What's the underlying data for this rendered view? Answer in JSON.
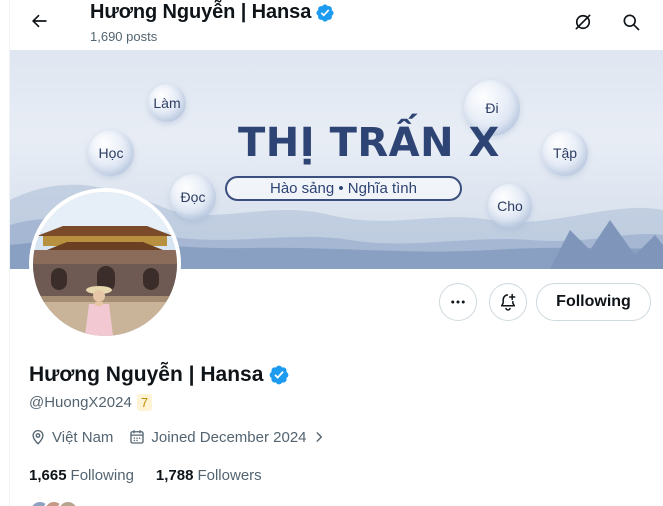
{
  "header": {
    "name": "Hương Nguyễn | Hansa",
    "posts_count": "1,690 posts"
  },
  "banner": {
    "title": "THỊ TRẤN X",
    "tagline": "Hào sảng • Nghĩa tình",
    "bubbles": [
      "Làm",
      "Học",
      "Đọc",
      "Đi",
      "Tập",
      "Cho"
    ]
  },
  "actions": {
    "following_label": "Following"
  },
  "profile": {
    "display_name": "Hương Nguyễn | Hansa",
    "handle": "@HuongX2024",
    "badge": "7",
    "location": "Việt Nam",
    "joined": "Joined December 2024",
    "following_count": "1,665",
    "following_label": "Following",
    "followers_count": "1,788",
    "followers_label": "Followers"
  },
  "colors": {
    "verified": "#1d9bf0",
    "text_primary": "#0f1419",
    "text_secondary": "#536471",
    "banner_text": "#2e4474"
  }
}
